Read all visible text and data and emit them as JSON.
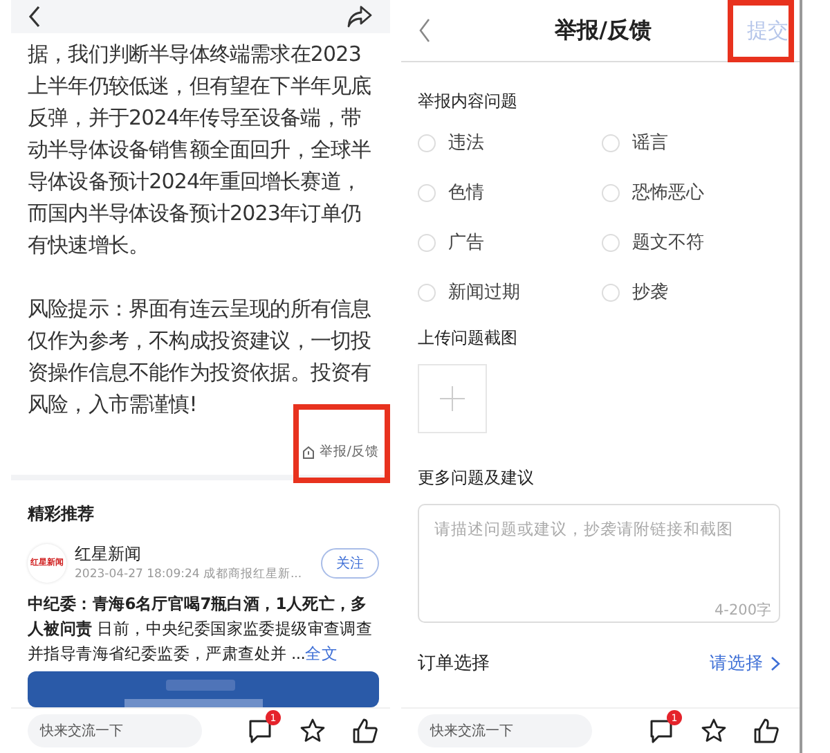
{
  "article": {
    "paragraphs": [
      "据，我们判断半导体终端需求在2023上半年仍较低迷，但有望在下半年见底反弹，并于2024年传导至设备端，带动半导体设备销售额全面回升，全球半导体设备预计2024年重回增长赛道，而国内半导体设备预计2023年订单仍有快速增长。",
      "风险提示：界面有连云呈现的所有信息仅作为参考，不构成投资建议，一切投资操作信息不能作为投资依据。投资有风险，入市需谨慎!"
    ],
    "report_link": {
      "label": "举报/反馈",
      "highlighted": true
    },
    "recommend": {
      "title": "精彩推荐",
      "items": [
        {
          "logo": "红星新闻",
          "source": "红星新闻",
          "meta": "2023-04-27 18:09:24  成都商报红星新...",
          "follow": "关注",
          "headline": "中纪委：青海6名厅官喝7瓶白酒，1人死亡，多人被问责",
          "summary": "日前，中央纪委国家监委提级审查调查并指导青海省纪委监委，严肃查处并 ...",
          "more": "全文"
        }
      ]
    },
    "comment_bar": {
      "placeholder": "快来交流一下",
      "badge": "1"
    }
  },
  "report_form": {
    "title": "举报/反馈",
    "submit": {
      "label": "提交",
      "disabled": true,
      "highlighted": true
    },
    "content_label": "举报内容问题",
    "options": [
      {
        "label": "违法",
        "selected": false
      },
      {
        "label": "谣言",
        "selected": false
      },
      {
        "label": "色情",
        "selected": false
      },
      {
        "label": "恐怖恶心",
        "selected": false
      },
      {
        "label": "广告",
        "selected": false
      },
      {
        "label": "题文不符",
        "selected": false
      },
      {
        "label": "新闻过期",
        "selected": false
      },
      {
        "label": "抄袭",
        "selected": false
      }
    ],
    "upload_label": "上传问题截图",
    "suggestion_label": "更多问题及建议",
    "suggestion": {
      "placeholder": "请描述问题或建议，抄袭请附链接和截图",
      "counter": "4-200字"
    },
    "order": {
      "label": "订单选择",
      "action": "请选择"
    },
    "comment_bar": {
      "placeholder": "快来交流一下",
      "badge": "1"
    }
  }
}
